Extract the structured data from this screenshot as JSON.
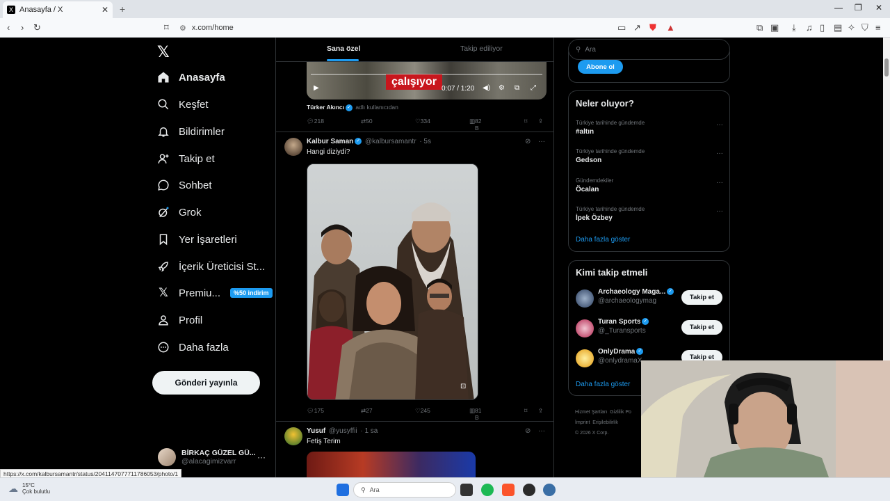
{
  "browser": {
    "tab_title": "Anasayfa / X",
    "url": "x.com/home",
    "status_url": "https://x.com/kalbursamantr/status/2041147077711786053/photo/1"
  },
  "nav": {
    "items": [
      {
        "label": "Anasayfa",
        "icon": "home-icon"
      },
      {
        "label": "Keşfet",
        "icon": "search-icon"
      },
      {
        "label": "Bildirimler",
        "icon": "bell-icon"
      },
      {
        "label": "Takip et",
        "icon": "person-add-icon"
      },
      {
        "label": "Sohbet",
        "icon": "chat-icon"
      },
      {
        "label": "Grok",
        "icon": "grok-icon"
      },
      {
        "label": "Yer İşaretleri",
        "icon": "bookmark-icon"
      },
      {
        "label": "İçerik Üreticisi St...",
        "icon": "rocket-icon"
      },
      {
        "label": "Premiu...",
        "icon": "x-logo-icon"
      },
      {
        "label": "Profil",
        "icon": "profile-icon"
      },
      {
        "label": "Daha fazla",
        "icon": "more-circle-icon"
      }
    ],
    "premium_badge": "%50 indirim",
    "post_button": "Gönderi yayınla",
    "profile": {
      "name": "BİRKAÇ GÜZEL GÜ...",
      "handle": "@alacagimizvarr"
    }
  },
  "feed": {
    "tabs": {
      "for_you": "Sana özel",
      "following": "Takip ediliyor"
    },
    "video": {
      "overlay_text": "çalışıyor",
      "time": "0:07 / 1:20"
    },
    "video_tweet": {
      "author": "Türker Akıncı",
      "note": "adlı kullanıcıdan",
      "replies": "218",
      "reposts": "50",
      "likes": "334",
      "views": "82 B"
    },
    "tweet1": {
      "name": "Kalbur Saman",
      "handle": "@kalbursamantr",
      "time": "· 5s",
      "text": "Hangi diziydi?",
      "replies": "175",
      "reposts": "27",
      "likes": "245",
      "views": "81 B"
    },
    "tweet2": {
      "name": "Yusuf",
      "handle": "@yusyffii",
      "time": "· 1 sa",
      "text": "Fetiş Terim"
    }
  },
  "right": {
    "search_placeholder": "Ara",
    "subscribe_button": "Abone ol",
    "trends_title": "Neler oluyor?",
    "trends": [
      {
        "context": "Türkiye tarihinde gündemde",
        "name": "#altın"
      },
      {
        "context": "Türkiye tarihinde gündemde",
        "name": "Gedson"
      },
      {
        "context": "Gündemdekiler",
        "name": "Öcalan"
      },
      {
        "context": "Türkiye tarihinde gündemde",
        "name": "İpek Özbey"
      }
    ],
    "trends_show_more": "Daha fazla göster",
    "who_title": "Kimi takip etmeli",
    "who": [
      {
        "name": "Archaeology Maga...",
        "handle": "@archaeologymag",
        "button": "Takip et"
      },
      {
        "name": "Turan Sports",
        "handle": "@_Turansports",
        "button": "Takip et"
      },
      {
        "name": "OnlyDrama",
        "handle": "@onlydramaX",
        "button": "Takip et"
      }
    ],
    "who_show_more": "Daha fazla göster",
    "footer": [
      "Hizmet Şartları",
      "Gizlilik Po",
      "İmprint",
      "Erişilebilirlik",
      "© 2026 X Corp."
    ]
  },
  "taskbar": {
    "temp": "15°C",
    "weather": "Çok bulutlu",
    "search": "Ara"
  },
  "colors": {
    "accent": "#1d9bf0",
    "background": "#000000",
    "border": "#2f3336",
    "muted": "#71767b"
  }
}
